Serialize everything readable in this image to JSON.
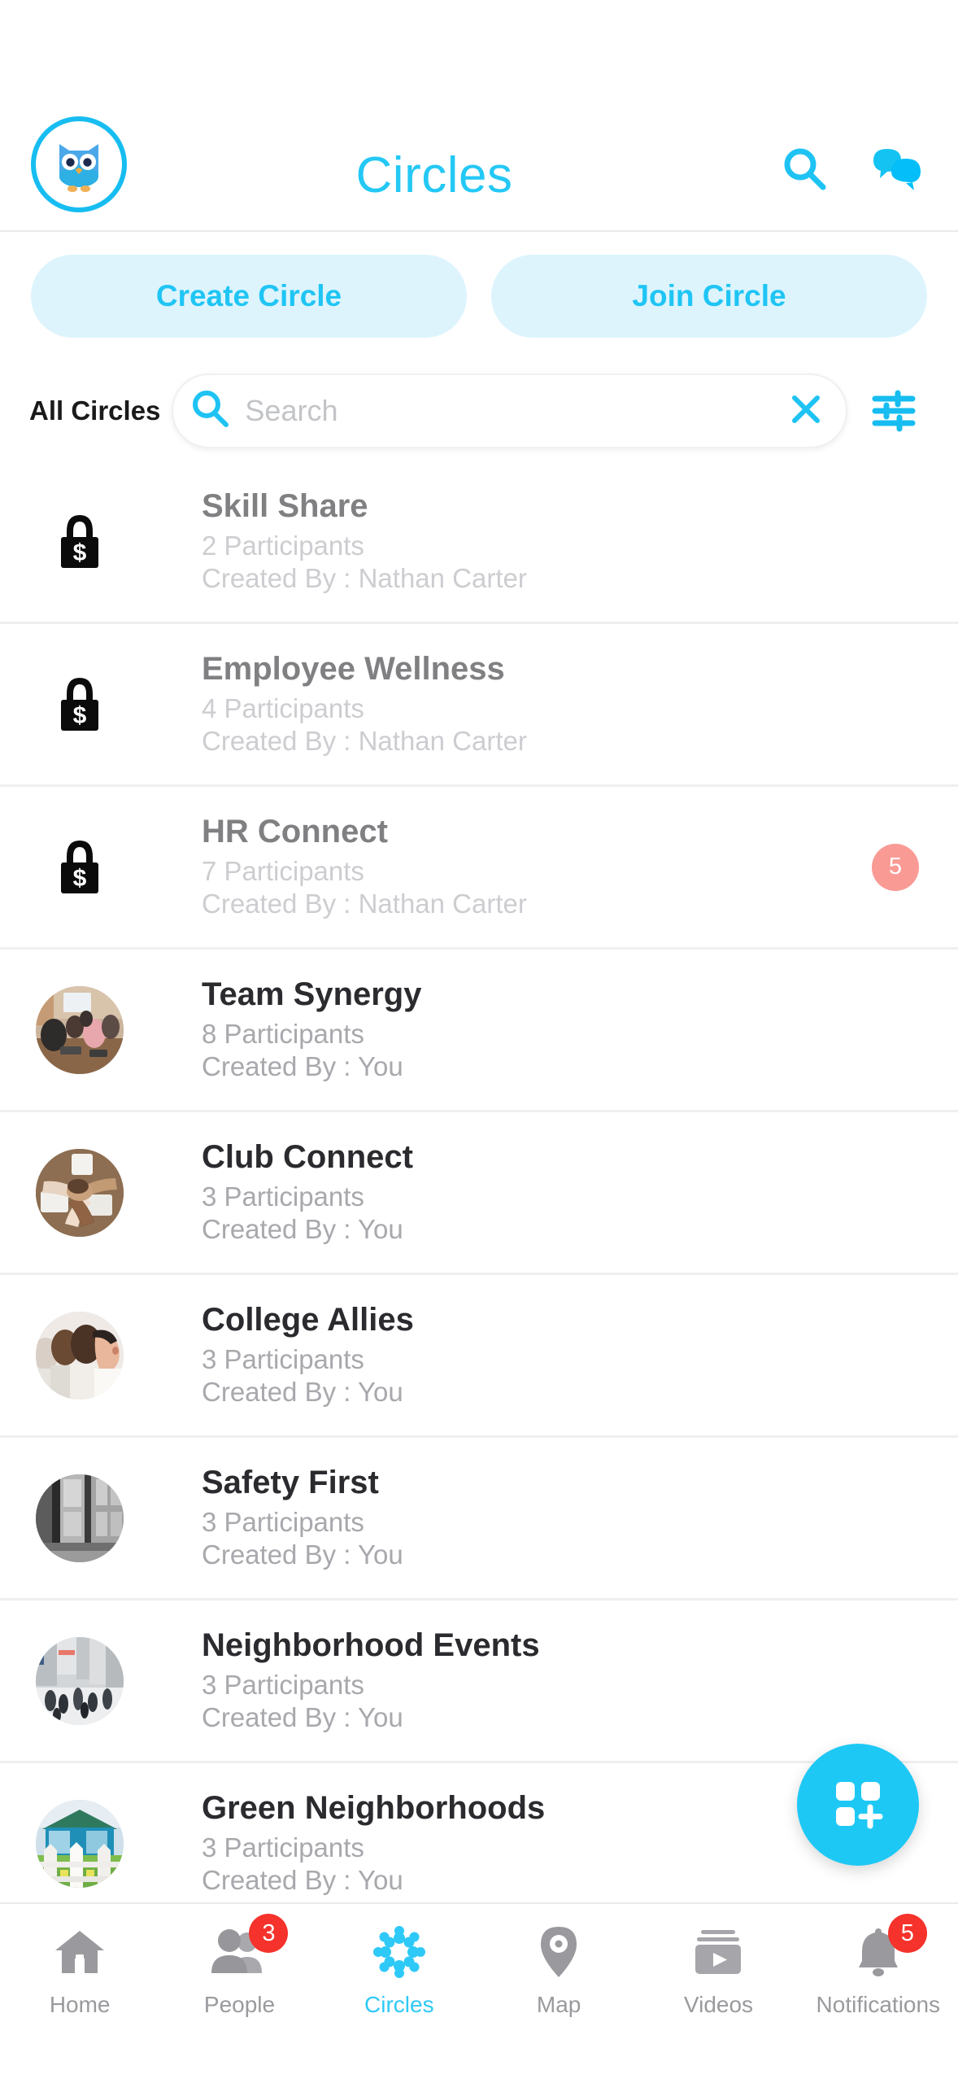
{
  "header": {
    "logo_icon": "owl-logo-icon",
    "title": "Circles",
    "search_icon": "search-icon",
    "chat_icon": "chat-bubbles-icon"
  },
  "actions": {
    "create_label": "Create Circle",
    "join_label": "Join Circle"
  },
  "filters": {
    "all_circles_label": "All Circles",
    "search_placeholder": "Search",
    "search_value": "",
    "search_icon": "search-icon",
    "clear_icon": "close-x-icon",
    "filter_icon": "filter-sliders-icon"
  },
  "circles": [
    {
      "name": "Skill Share",
      "participants": "2 Participants",
      "creator": "Created By : Nathan Carter",
      "locked": true,
      "icon": "lock-dollar-icon",
      "badge": ""
    },
    {
      "name": "Employee Wellness",
      "participants": "4 Participants",
      "creator": "Created By : Nathan Carter",
      "locked": true,
      "icon": "lock-dollar-icon",
      "badge": ""
    },
    {
      "name": "HR Connect",
      "participants": "7 Participants",
      "creator": "Created By : Nathan Carter",
      "locked": true,
      "icon": "lock-dollar-icon",
      "badge": "5"
    },
    {
      "name": "Team Synergy",
      "participants": "8 Participants",
      "creator": "Created By : You",
      "locked": false,
      "icon": "circle-avatar-meeting",
      "badge": ""
    },
    {
      "name": "Club Connect",
      "participants": "3 Participants",
      "creator": "Created By : You",
      "locked": false,
      "icon": "circle-avatar-hands",
      "badge": ""
    },
    {
      "name": "College Allies",
      "participants": "3 Participants",
      "creator": "Created By : You",
      "locked": false,
      "icon": "circle-avatar-students",
      "badge": ""
    },
    {
      "name": "Safety First",
      "participants": "3 Participants",
      "creator": "Created By : You",
      "locked": false,
      "icon": "circle-avatar-building",
      "badge": ""
    },
    {
      "name": "Neighborhood Events",
      "participants": "3 Participants",
      "creator": "Created By : You",
      "locked": false,
      "icon": "circle-avatar-street",
      "badge": ""
    },
    {
      "name": "Green Neighborhoods",
      "participants": "3 Participants",
      "creator": "Created By : You",
      "locked": false,
      "icon": "circle-avatar-house",
      "badge": ""
    }
  ],
  "fab": {
    "icon": "grid-plus-icon"
  },
  "bottom_nav": {
    "items": [
      {
        "label": "Home",
        "icon": "home-icon",
        "badge": "",
        "active": false
      },
      {
        "label": "People",
        "icon": "people-icon",
        "badge": "3",
        "active": false
      },
      {
        "label": "Circles",
        "icon": "circles-ring-icon",
        "badge": "",
        "active": true
      },
      {
        "label": "Map",
        "icon": "map-pin-icon",
        "badge": "",
        "active": false
      },
      {
        "label": "Videos",
        "icon": "videos-icon",
        "badge": "",
        "active": false
      },
      {
        "label": "Notifications",
        "icon": "bell-icon",
        "badge": "5",
        "active": false
      }
    ]
  },
  "colors": {
    "accent": "#24c8f5",
    "pill_bg": "#ddf4fd",
    "badge_pink": "#fa9a94",
    "badge_red": "#f5322b",
    "nav_grey": "#9a9a9e"
  }
}
